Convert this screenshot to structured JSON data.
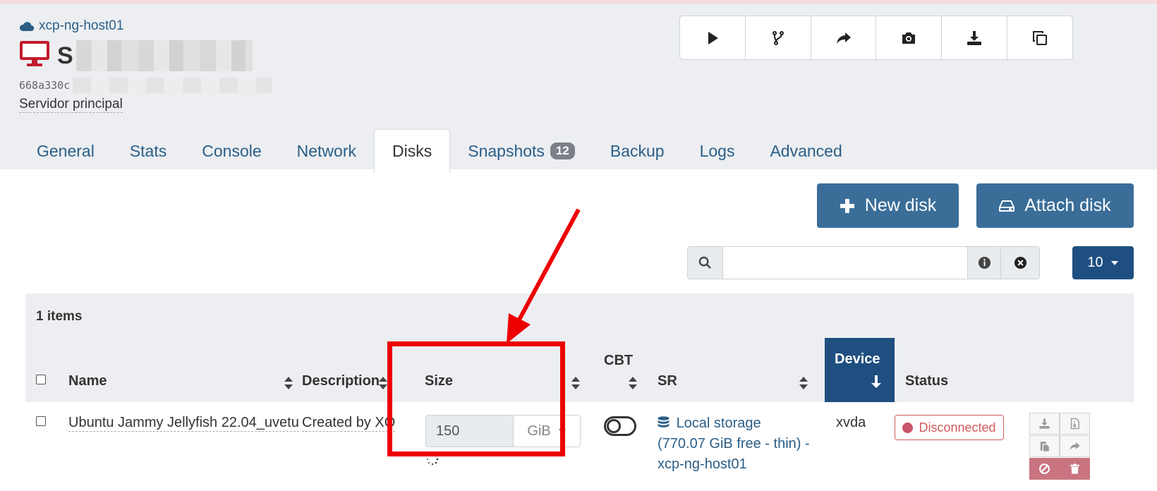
{
  "header": {
    "host_link": "xcp-ng-host01",
    "vm_name_initial": "S",
    "vm_uuid_prefix": "668a330c",
    "vm_description": "Servidor principal"
  },
  "toolbar": {
    "buttons": [
      {
        "icon": "play-icon",
        "label": "Start"
      },
      {
        "icon": "fork-icon",
        "label": "Fast clone"
      },
      {
        "icon": "share-icon",
        "label": "Migrate"
      },
      {
        "icon": "camera-icon",
        "label": "Snapshot"
      },
      {
        "icon": "download-icon",
        "label": "Export"
      },
      {
        "icon": "copy-icon",
        "label": "Copy"
      }
    ]
  },
  "tabs": [
    {
      "label": "General"
    },
    {
      "label": "Stats"
    },
    {
      "label": "Console"
    },
    {
      "label": "Network"
    },
    {
      "label": "Disks",
      "active": true
    },
    {
      "label": "Snapshots",
      "badge": "12"
    },
    {
      "label": "Backup"
    },
    {
      "label": "Logs"
    },
    {
      "label": "Advanced"
    }
  ],
  "actions": {
    "new_disk": "New disk",
    "attach_disk": "Attach disk"
  },
  "search": {
    "value": "",
    "placeholder": ""
  },
  "pager": {
    "page_size": "10"
  },
  "table": {
    "items_count": "1 items",
    "columns": {
      "name": "Name",
      "description": "Description",
      "size": "Size",
      "cbt": "CBT",
      "sr": "SR",
      "device": "Device",
      "status": "Status"
    },
    "row": {
      "name": "Ubuntu Jammy Jellyfish 22.04_uvetu",
      "description": "Created by XO",
      "size_value": "150",
      "size_unit": "GiB",
      "cbt_enabled": false,
      "sr": "Local storage (770.07 GiB free - thin) - xcp-ng-host01",
      "device": "xvda",
      "status": "Disconnected"
    }
  },
  "colors": {
    "accent": "#3a6e99",
    "dark_accent": "#1f4f80",
    "link": "#2a5e87",
    "danger": "#d25a5a",
    "annotation": "#ee0000"
  }
}
